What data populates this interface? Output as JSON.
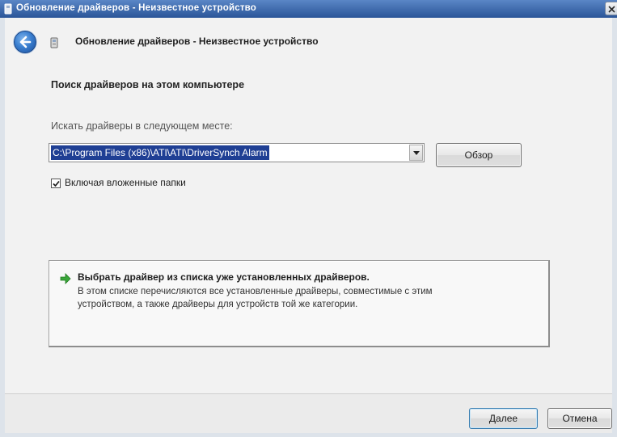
{
  "window": {
    "title": "Обновление драйверов - Неизвестное устройство",
    "app_icon": "device-icon",
    "close_icon": "close-icon"
  },
  "header": {
    "back_icon": "back-arrow-icon",
    "device_icon": "device-icon",
    "title": "Обновление драйверов - Неизвестное устройство"
  },
  "search": {
    "heading": "Поиск драйверов на этом компьютере",
    "location_label": "Искать драйверы в следующем месте:",
    "location_value": "C:\\Program Files (x86)\\ATI\\ATI\\DriverSynch Alarm",
    "dropdown_icon": "chevron-down-icon",
    "browse_label": "Обзор",
    "include_subfolders": {
      "label": "Включая вложенные папки",
      "checked": true
    }
  },
  "pick_from_list": {
    "icon": "green-arrow-icon",
    "title": "Выбрать драйвер из списка уже установленных драйверов.",
    "description": [
      "В этом списке перечисляются все установленные драйверы, совместимые с этим",
      "устройством, а также драйверы для устройств той же категории."
    ]
  },
  "footer": {
    "next_label": "Далее",
    "cancel_label": "Отмена"
  },
  "colors": {
    "titlebar_top": "#5a86c6",
    "titlebar_bottom": "#2a5598",
    "selection": "#1f3f94",
    "link_arrow": "#3aa63a"
  }
}
